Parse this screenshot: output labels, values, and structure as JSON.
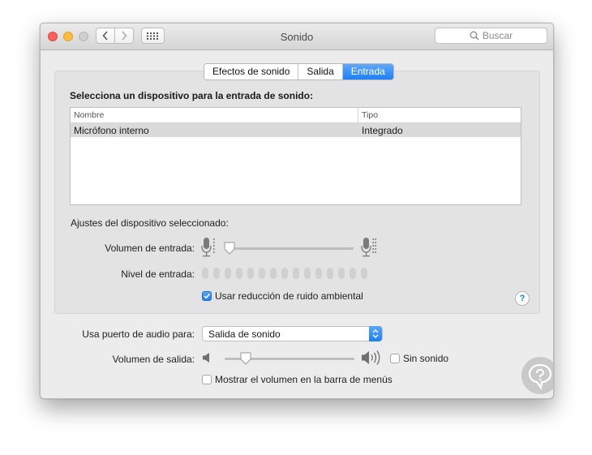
{
  "window": {
    "title": "Sonido"
  },
  "search": {
    "placeholder": "Buscar"
  },
  "tabs": [
    {
      "label": "Efectos de sonido",
      "active": false
    },
    {
      "label": "Salida",
      "active": false
    },
    {
      "label": "Entrada",
      "active": true
    }
  ],
  "input": {
    "section_title": "Selecciona un dispositivo para la entrada de sonido:",
    "columns": [
      "Nombre",
      "Tipo"
    ],
    "rows": [
      {
        "name": "Micrófono interno",
        "type": "Integrado",
        "selected": true
      }
    ],
    "settings_label": "Ajustes del dispositivo seleccionado:",
    "volume_label": "Volumen de entrada:",
    "volume_level": 0.03,
    "level_label": "Nivel de entrada:",
    "level_value": 0,
    "noise_reduction_label": "Usar reducción de ruido ambiental",
    "noise_reduction_checked": true
  },
  "footer": {
    "audio_port_label": "Usa puerto de audio para:",
    "audio_port_value": "Salida de sonido",
    "output_volume_label": "Volumen de salida:",
    "output_volume_level": 0.16,
    "mute_label": "Sin sonido",
    "mute_checked": false,
    "menubar_label": "Mostrar el volumen en la barra de menús",
    "menubar_checked": false
  },
  "colors": {
    "accent": "#1d7ef2",
    "close": "#fc605b",
    "minimize": "#fdbc40"
  }
}
